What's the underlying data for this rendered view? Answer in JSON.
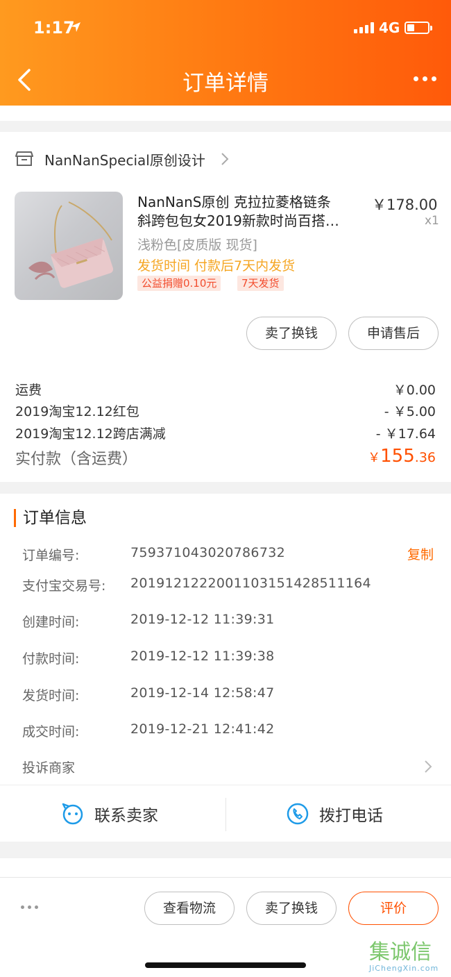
{
  "status_bar": {
    "time": "1:17",
    "network": "4G"
  },
  "nav": {
    "title": "订单详情"
  },
  "shop": {
    "name": "NanNanSpecial原创设计"
  },
  "product": {
    "title_line1": "NanNanS原创 克拉拉菱格链条",
    "title_line2": "斜跨包包女2019新款时尚百搭…",
    "price": "￥178.00",
    "quantity": "x1",
    "variant": "浅粉色[皮质版 现货]",
    "ship_time": "发货时间  付款后7天内发货",
    "tags": [
      "公益捐赠0.10元",
      "7天发货"
    ],
    "actions": [
      "卖了换钱",
      "申请售后"
    ]
  },
  "fees": [
    {
      "label": "运费",
      "value": "￥0.00"
    },
    {
      "label": "2019淘宝12.12红包",
      "value": "- ￥5.00"
    },
    {
      "label": "2019淘宝12.12跨店满减",
      "value": "- ￥17.64"
    }
  ],
  "total": {
    "label": "实付款（含运费）",
    "currency": "￥",
    "integer": "155",
    "decimal": ".36"
  },
  "order_info": {
    "title": "订单信息",
    "copy_label": "复制",
    "rows": [
      {
        "label": "订单编号:",
        "value": "759371043020786732"
      },
      {
        "label": "支付宝交易号:",
        "value": "2019121222001103151428511164"
      },
      {
        "label": "创建时间:",
        "value": "2019-12-12 11:39:31"
      },
      {
        "label": "付款时间:",
        "value": "2019-12-12 11:39:38"
      },
      {
        "label": "发货时间:",
        "value": "2019-12-14 12:58:47"
      },
      {
        "label": "成交时间:",
        "value": "2019-12-21 12:41:42"
      }
    ],
    "complain": "投诉商家"
  },
  "contact": {
    "seller": "联系卖家",
    "call": "拨打电话"
  },
  "bottom_actions": [
    "查看物流",
    "卖了换钱",
    "评价"
  ],
  "colors": {
    "accent": "#ff5000",
    "header_start": "#ff9a1f",
    "header_end": "#ff5a0a"
  },
  "watermark": {
    "mark": "集诚信",
    "text": "JiChengXin.com"
  }
}
